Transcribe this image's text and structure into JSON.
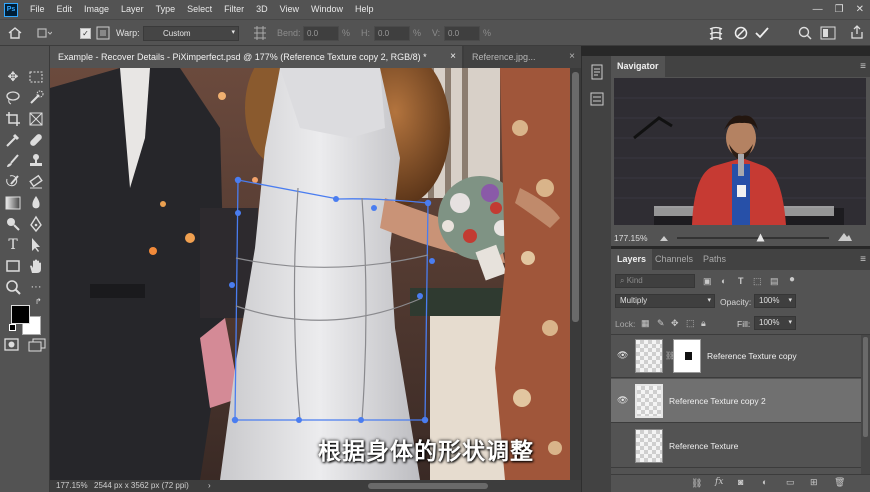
{
  "app": {
    "logo": "Ps"
  },
  "menu": [
    "File",
    "Edit",
    "Image",
    "Layer",
    "Type",
    "Select",
    "Filter",
    "3D",
    "View",
    "Window",
    "Help"
  ],
  "window_controls": {
    "minimize": "—",
    "restore": "❐",
    "close": "✕"
  },
  "options": {
    "warp_label": "Warp:",
    "warp_value": "Custom",
    "bend_label": "Bend:",
    "bend_value": "0.0",
    "h_label": "H:",
    "h_value": "0.0",
    "v_label": "V:",
    "v_value": "0.0",
    "percent": "%"
  },
  "tabs": [
    {
      "label": "Example - Recover Details - PiXimperfect.psd @ 177% (Reference Texture copy 2, RGB/8) *",
      "close": "×"
    },
    {
      "label": "Reference.jpg...",
      "close": "×"
    }
  ],
  "canvas": {
    "subtitle": "根据身体的形状调整"
  },
  "status": {
    "zoom": "177.15%",
    "info": "2544 px x 3562 px (72 ppi)",
    "arrow": "›"
  },
  "navigator": {
    "title": "Navigator",
    "zoom": "177.15%"
  },
  "layers_panel": {
    "tabs": [
      "Layers",
      "Channels",
      "Paths"
    ],
    "kind_placeholder": "Kind",
    "blend_mode": "Multiply",
    "opacity_label": "Opacity:",
    "opacity_value": "100%",
    "lock_label": "Lock:",
    "fill_label": "Fill:",
    "fill_value": "100%",
    "layers": [
      {
        "name": "Reference Texture copy",
        "visible": true,
        "selected": false,
        "has_mask": true
      },
      {
        "name": "Reference Texture copy 2",
        "visible": true,
        "selected": true,
        "has_mask": false
      },
      {
        "name": "Reference Texture",
        "visible": false,
        "selected": false,
        "has_mask": false
      }
    ],
    "footer_icons": [
      "link-icon",
      "fx-icon",
      "mask-icon",
      "adjustment-icon",
      "group-icon",
      "new-layer-icon",
      "trash-icon"
    ]
  },
  "colors": {
    "accent": "#31a8ff",
    "warp_grid": "#4a7df0",
    "selected_layer": "#707070",
    "panel_bg": "#535353"
  }
}
